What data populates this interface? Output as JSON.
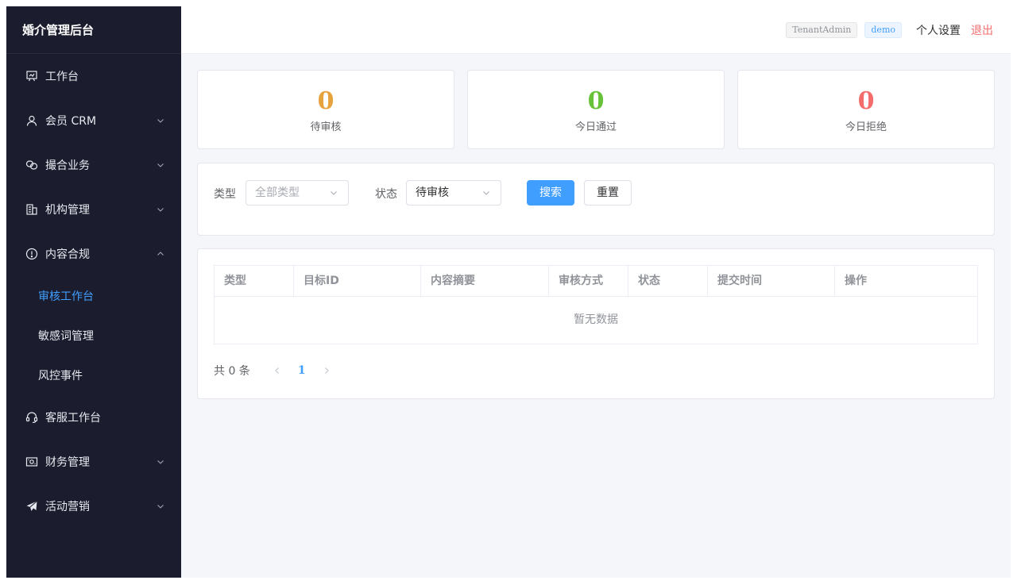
{
  "app": {
    "title": "婚介管理后台"
  },
  "sidebar": {
    "items": [
      {
        "label": "工作台",
        "icon": "presentation-board-icon"
      },
      {
        "label": "会员 CRM",
        "icon": "user-icon"
      },
      {
        "label": "撮合业务",
        "icon": "link-icon"
      },
      {
        "label": "机构管理",
        "icon": "building-icon"
      },
      {
        "label": "内容合规",
        "icon": "warning-circle-icon"
      },
      {
        "label": "客服工作台",
        "icon": "headset-icon"
      },
      {
        "label": "财务管理",
        "icon": "wallet-icon"
      },
      {
        "label": "活动营销",
        "icon": "paper-plane-icon"
      }
    ],
    "submenu": [
      {
        "label": "审核工作台",
        "active": true
      },
      {
        "label": "敏感词管理"
      },
      {
        "label": "风控事件"
      }
    ]
  },
  "header": {
    "tenant_tag": "TenantAdmin",
    "user_tag": "demo",
    "settings": "个人设置",
    "logout": "退出"
  },
  "stats": [
    {
      "value": "0",
      "label": "待审核",
      "color": "#e6a23c"
    },
    {
      "value": "0",
      "label": "今日通过",
      "color": "#67c23a"
    },
    {
      "value": "0",
      "label": "今日拒绝",
      "color": "#f56c6c"
    }
  ],
  "filters": {
    "type_label": "类型",
    "type_placeholder": "全部类型",
    "status_label": "状态",
    "status_value": "待审核",
    "search_btn": "搜索",
    "reset_btn": "重置"
  },
  "table": {
    "columns": [
      "类型",
      "目标ID",
      "内容摘要",
      "审核方式",
      "状态",
      "提交时间",
      "操作"
    ],
    "empty_text": "暂无数据"
  },
  "pagination": {
    "total_text": "共 0 条",
    "current": "1"
  },
  "colors": {
    "sidebar_bg": "#1b1d2e",
    "primary": "#409eff",
    "danger": "#f56c6c"
  }
}
